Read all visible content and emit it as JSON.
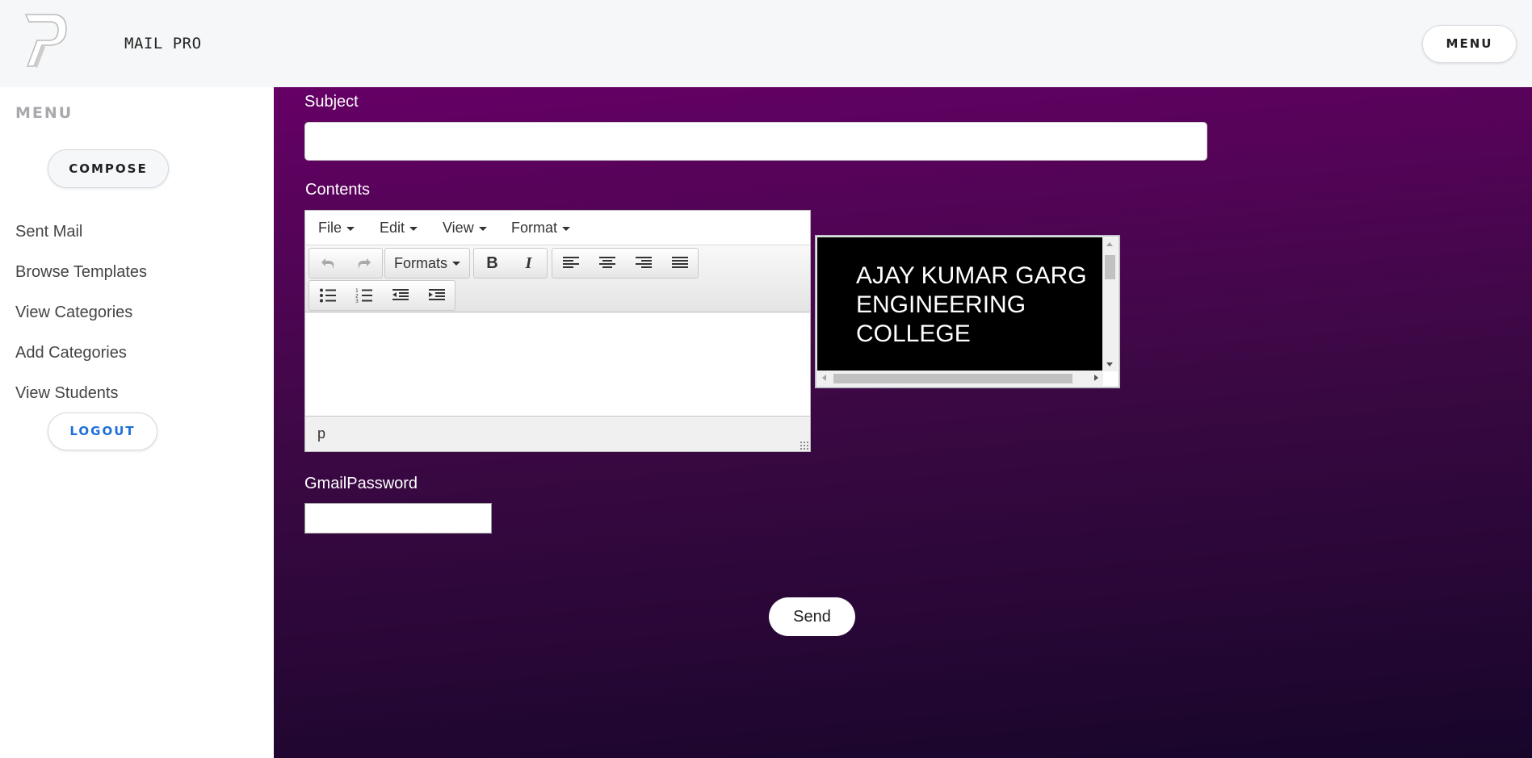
{
  "header": {
    "logo_icon": "stylized-p-logo-icon",
    "app_title": "MAIL PRO",
    "menu_button": "MENU"
  },
  "sidebar": {
    "heading": "MENU",
    "compose_button": "COMPOSE",
    "links": [
      "Sent Mail",
      "Browse Templates",
      "View Categories",
      "Add Categories",
      "View Students"
    ],
    "logout_button": "LOGOUT"
  },
  "form": {
    "subject_label": "Subject",
    "subject_value": "",
    "contents_label": "Contents",
    "password_label": "GmailPassword",
    "password_value": "",
    "send_button": "Send"
  },
  "editor": {
    "menus": [
      "File",
      "Edit",
      "View",
      "Format"
    ],
    "formats_label": "Formats",
    "toolbar_icons": [
      "undo-icon",
      "redo-icon",
      "bold-icon",
      "italic-icon",
      "align-left-icon",
      "align-center-icon",
      "align-right-icon",
      "align-justify-icon",
      "bullet-list-icon",
      "numbered-list-icon",
      "outdent-icon",
      "indent-icon"
    ],
    "status_path": "p"
  },
  "preview": {
    "text": "AJAY KUMAR GARG ENGINEERING COLLEGE"
  },
  "colors": {
    "gradient_top": "#660066",
    "gradient_bottom": "#17062a",
    "logout_text": "#1f6fd8"
  }
}
